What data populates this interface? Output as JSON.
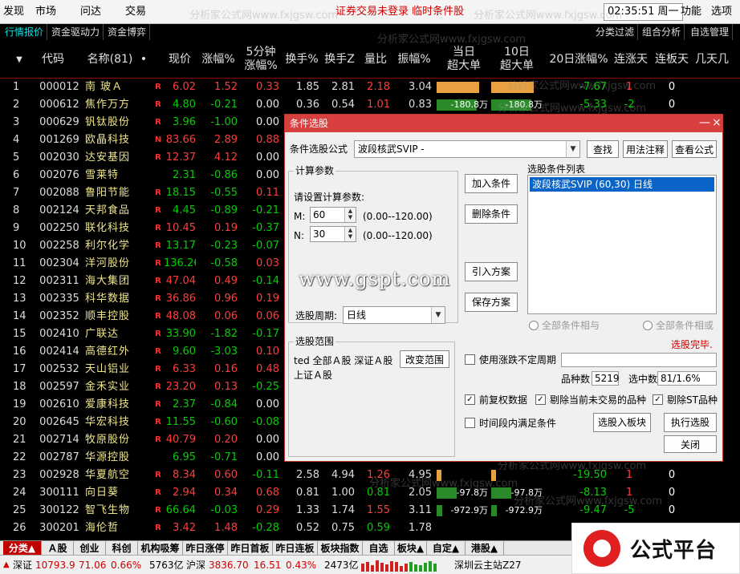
{
  "menubar": {
    "items": [
      "发现",
      "市场",
      "问达",
      "交易"
    ],
    "status_text": "证券交易未登录  临时条件股",
    "clock": "02:35:51 周一",
    "right_items": [
      "功能",
      "选项"
    ]
  },
  "tabs": {
    "left": [
      "行情报价",
      "资金驱动力",
      "资金博弈"
    ],
    "right": [
      "分类过滤",
      "组合分析",
      "自选管理"
    ]
  },
  "columns": {
    "sort": "▼",
    "code": "代码",
    "name": "名称(81)",
    "dot": "•",
    "price": "现价",
    "chg": "涨幅%",
    "min5": "5分钟\n涨幅%",
    "turnover": "换手%",
    "turnover_z": "换手Z",
    "vol_ratio": "量比",
    "amplitude": "振幅%",
    "day_big": "当日\n超大单",
    "ten_day_big": "10日\n超大单",
    "chg20": "20日涨幅%",
    "up_days": "连涨天",
    "limit_days": "连板天",
    "days_limit": "几天几"
  },
  "rows": [
    {
      "idx": "1",
      "code": "000012",
      "name": "南 玻Ａ",
      "flag": "R",
      "price": "6.02",
      "chg": "1.52",
      "min5": "0.33",
      "turn": "1.85",
      "turnz": "2.81",
      "vr": "2.18",
      "amp": "3.04",
      "b1": "2582万",
      "b1v": 0.85,
      "b2": "2582万",
      "b2v": 0.85,
      "c20": "-7.67",
      "up": "1",
      "lim": "0"
    },
    {
      "idx": "2",
      "code": "000612",
      "name": "焦作万方",
      "flag": "R",
      "price": "4.80",
      "chg": "-0.21",
      "min5": "0.00",
      "turn": "0.36",
      "turnz": "0.54",
      "vr": "1.01",
      "amp": "0.83",
      "b1": "-180.8万",
      "b1v": -0.8,
      "b2": "-180.8万",
      "b2v": -0.8,
      "c20": "-5.33",
      "up": "-2",
      "lim": "0"
    },
    {
      "idx": "3",
      "code": "000629",
      "name": "钒钛股份",
      "flag": "R",
      "price": "3.96",
      "chg": "-1.00",
      "min5": "0.00",
      "turn": "",
      "turnz": "",
      "vr": "",
      "amp": "",
      "b1": "",
      "b2": "",
      "c20": "",
      "up": "",
      "lim": ""
    },
    {
      "idx": "4",
      "code": "001269",
      "name": "欧晶科技",
      "flag": "N",
      "price": "83.66",
      "chg": "2.89",
      "min5": "0.88",
      "turn": "",
      "turnz": "",
      "vr": "",
      "amp": "",
      "b1": "",
      "b2": "",
      "c20": "",
      "up": "",
      "lim": ""
    },
    {
      "idx": "5",
      "code": "002030",
      "name": "达安基因",
      "flag": "R",
      "price": "12.37",
      "chg": "4.12",
      "min5": "0.00",
      "turn": "",
      "turnz": "",
      "vr": "",
      "amp": "",
      "b1": "",
      "b2": "",
      "c20": "",
      "up": "",
      "lim": ""
    },
    {
      "idx": "6",
      "code": "002076",
      "name": "雪莱特",
      "flag": "",
      "price": "2.31",
      "chg": "-0.86",
      "min5": "0.00",
      "turn": "",
      "turnz": "",
      "vr": "",
      "amp": "",
      "b1": "",
      "b2": "",
      "c20": "",
      "up": "",
      "lim": ""
    },
    {
      "idx": "7",
      "code": "002088",
      "name": "鲁阳节能",
      "flag": "R",
      "price": "18.15",
      "chg": "-0.55",
      "min5": "0.11",
      "turn": "",
      "turnz": "",
      "vr": "",
      "amp": "",
      "b1": "",
      "b2": "",
      "c20": "",
      "up": "",
      "lim": ""
    },
    {
      "idx": "8",
      "code": "002124",
      "name": "天邦食品",
      "flag": "R",
      "price": "4.45",
      "chg": "-0.89",
      "min5": "-0.21",
      "turn": "",
      "turnz": "",
      "vr": "",
      "amp": "",
      "b1": "",
      "b2": "",
      "c20": "",
      "up": "",
      "lim": ""
    },
    {
      "idx": "9",
      "code": "002250",
      "name": "联化科技",
      "flag": "R",
      "price": "10.45",
      "chg": "0.19",
      "min5": "-0.37",
      "turn": "",
      "turnz": "",
      "vr": "",
      "amp": "",
      "b1": "",
      "b2": "",
      "c20": "",
      "up": "",
      "lim": ""
    },
    {
      "idx": "10",
      "code": "002258",
      "name": "利尔化学",
      "flag": "R",
      "price": "13.17",
      "chg": "-0.23",
      "min5": "-0.07",
      "turn": "",
      "turnz": "",
      "vr": "",
      "amp": "",
      "b1": "",
      "b2": "",
      "c20": "",
      "up": "",
      "lim": ""
    },
    {
      "idx": "11",
      "code": "002304",
      "name": "洋河股份",
      "flag": "R",
      "price": "136.26",
      "chg": "-0.58",
      "min5": "0.03",
      "turn": "",
      "turnz": "",
      "vr": "",
      "amp": "",
      "b1": "",
      "b2": "",
      "c20": "",
      "up": "",
      "lim": ""
    },
    {
      "idx": "12",
      "code": "002311",
      "name": "海大集团",
      "flag": "R",
      "price": "47.04",
      "chg": "0.49",
      "min5": "-0.14",
      "turn": "",
      "turnz": "",
      "vr": "",
      "amp": "",
      "b1": "",
      "b2": "",
      "c20": "",
      "up": "",
      "lim": ""
    },
    {
      "idx": "13",
      "code": "002335",
      "name": "科华数据",
      "flag": "R",
      "price": "36.86",
      "chg": "0.96",
      "min5": "0.19",
      "turn": "",
      "turnz": "",
      "vr": "",
      "amp": "",
      "b1": "",
      "b2": "",
      "c20": "",
      "up": "",
      "lim": ""
    },
    {
      "idx": "14",
      "code": "002352",
      "name": "顺丰控股",
      "flag": "R",
      "price": "48.08",
      "chg": "0.06",
      "min5": "0.06",
      "turn": "",
      "turnz": "",
      "vr": "",
      "amp": "",
      "b1": "",
      "b2": "",
      "c20": "",
      "up": "",
      "lim": ""
    },
    {
      "idx": "15",
      "code": "002410",
      "name": "广联达",
      "flag": "R",
      "price": "33.90",
      "chg": "-1.82",
      "min5": "-0.17",
      "turn": "",
      "turnz": "",
      "vr": "",
      "amp": "",
      "b1": "",
      "b2": "",
      "c20": "",
      "up": "",
      "lim": ""
    },
    {
      "idx": "16",
      "code": "002414",
      "name": "高德红外",
      "flag": "R",
      "price": "9.60",
      "chg": "-3.03",
      "min5": "0.10",
      "turn": "",
      "turnz": "",
      "vr": "",
      "amp": "",
      "b1": "",
      "b2": "",
      "c20": "",
      "up": "",
      "lim": ""
    },
    {
      "idx": "17",
      "code": "002532",
      "name": "天山铝业",
      "flag": "R",
      "price": "6.33",
      "chg": "0.16",
      "min5": "0.48",
      "turn": "",
      "turnz": "",
      "vr": "",
      "amp": "",
      "b1": "",
      "b2": "",
      "c20": "",
      "up": "",
      "lim": ""
    },
    {
      "idx": "18",
      "code": "002597",
      "name": "金禾实业",
      "flag": "R",
      "price": "23.20",
      "chg": "0.13",
      "min5": "-0.25",
      "turn": "",
      "turnz": "",
      "vr": "",
      "amp": "",
      "b1": "",
      "b2": "",
      "c20": "",
      "up": "",
      "lim": ""
    },
    {
      "idx": "19",
      "code": "002610",
      "name": "爱康科技",
      "flag": "R",
      "price": "2.37",
      "chg": "-0.84",
      "min5": "0.00",
      "turn": "",
      "turnz": "",
      "vr": "",
      "amp": "",
      "b1": "",
      "b2": "",
      "c20": "",
      "up": "",
      "lim": ""
    },
    {
      "idx": "20",
      "code": "002645",
      "name": "华宏科技",
      "flag": "R",
      "price": "11.55",
      "chg": "-0.60",
      "min5": "-0.08",
      "turn": "",
      "turnz": "",
      "vr": "",
      "amp": "",
      "b1": "",
      "b2": "",
      "c20": "",
      "up": "",
      "lim": ""
    },
    {
      "idx": "21",
      "code": "002714",
      "name": "牧原股份",
      "flag": "R",
      "price": "40.79",
      "chg": "0.20",
      "min5": "0.00",
      "turn": "",
      "turnz": "",
      "vr": "",
      "amp": "",
      "b1": "",
      "b2": "",
      "c20": "",
      "up": "",
      "lim": ""
    },
    {
      "idx": "22",
      "code": "002787",
      "name": "华源控股",
      "flag": "",
      "price": "6.95",
      "chg": "-0.71",
      "min5": "0.00",
      "turn": "",
      "turnz": "",
      "vr": "",
      "amp": "",
      "b1": "",
      "b2": "",
      "c20": "",
      "up": "",
      "lim": ""
    },
    {
      "idx": "23",
      "code": "002928",
      "name": "华夏航空",
      "flag": "R",
      "price": "8.34",
      "chg": "0.60",
      "min5": "-0.11",
      "turn": "2.58",
      "turnz": "4.94",
      "vr": "1.26",
      "amp": "4.95",
      "b1": "226.3万",
      "b1v": 0.1,
      "b2": "226.3万",
      "b2v": 0.1,
      "c20": "-19.50",
      "up": "1",
      "lim": "0"
    },
    {
      "idx": "24",
      "code": "300111",
      "name": "向日葵",
      "flag": "R",
      "price": "2.94",
      "chg": "0.34",
      "min5": "0.68",
      "turn": "0.81",
      "turnz": "1.00",
      "vr": "0.81",
      "amp": "2.05",
      "b1": "-97.8万",
      "b1v": -0.4,
      "b2": "-97.8万",
      "b2v": -0.4,
      "c20": "-8.13",
      "up": "1",
      "lim": "0"
    },
    {
      "idx": "25",
      "code": "300122",
      "name": "智飞生物",
      "flag": "R",
      "price": "66.64",
      "chg": "-0.03",
      "min5": "0.29",
      "turn": "1.33",
      "turnz": "1.74",
      "vr": "1.55",
      "amp": "3.11",
      "b1": "-972.9万",
      "b1v": -0.12,
      "b2": "-972.9万",
      "b2v": -0.12,
      "c20": "-9.47",
      "up": "-5",
      "lim": "0"
    },
    {
      "idx": "26",
      "code": "300201",
      "name": "海伦哲",
      "flag": "R",
      "price": "3.42",
      "chg": "1.48",
      "min5": "-0.28",
      "turn": "0.52",
      "turnz": "0.75",
      "vr": "0.59",
      "amp": "1.78",
      "b1": "",
      "b2": "",
      "c20": "",
      "up": "",
      "lim": ""
    }
  ],
  "dialog": {
    "title": "条件选股",
    "formula_label": "条件选股公式",
    "formula_value": "波段核武SVIP -",
    "btn_find": "查找",
    "btn_usage": "用法注释",
    "btn_view": "查看公式",
    "params_group": "计算参数",
    "params_prompt": "请设置计算参数:",
    "m_label": "M:",
    "m_value": "60",
    "m_range": "(0.00--120.00)",
    "n_label": "N:",
    "n_value": "30",
    "n_range": "(0.00--120.00)",
    "period_label": "选股周期:",
    "period_value": "日线",
    "btn_add": "加入条件",
    "btn_delete": "删除条件",
    "btn_import": "引入方案",
    "btn_save": "保存方案",
    "list_label": "选股条件列表",
    "list_item": "波段核武SVIP (60,30) 日线",
    "radio_and": "全部条件相与",
    "radio_or": "全部条件相或",
    "done_text": "选股完毕.",
    "scope_group": "选股范围",
    "scope_text": "ted 全部Ａ股 深证Ａ股 上证Ａ股",
    "btn_change": "改变范围",
    "chk_period": "使用涨跌不定周期",
    "count_label": "品种数",
    "count_value": "5219",
    "selected_label": "选中数",
    "selected_value": "81/1.6%",
    "chk_adjust": "前复权数据",
    "chk_exclude_untraded": "剔除当前未交易的品种",
    "chk_exclude_st": "剔除ST品种",
    "chk_timespan": "时间段内满足条件",
    "btn_to_block": "选股入板块",
    "btn_run": "执行选股",
    "btn_close": "关闭"
  },
  "gspt_text": "www.gspt.com",
  "watermark_text": "分析家公式网www.fxjgsw.com",
  "bottom_tabs": [
    "分类▲",
    "Ａ股",
    "创业",
    "科创",
    "机构吸筹",
    "昨日涨停",
    "昨日首板",
    "昨日连板",
    "板块指数",
    "自选",
    "板块▲",
    "自定▲",
    "港股▲"
  ],
  "indexbar": {
    "sz_label": "深证",
    "sz_val": "10793.9",
    "sz_chg": "71.06",
    "sz_pct": "0.66%",
    "sz_amt": "5763亿",
    "hs_label": "沪深",
    "hs_val": "3836.70",
    "hs_chg": "16.51",
    "hs_pct": "0.43%",
    "hs_amt": "2473亿",
    "server": "深圳云主站Z27"
  },
  "logo_text": "公式平台"
}
